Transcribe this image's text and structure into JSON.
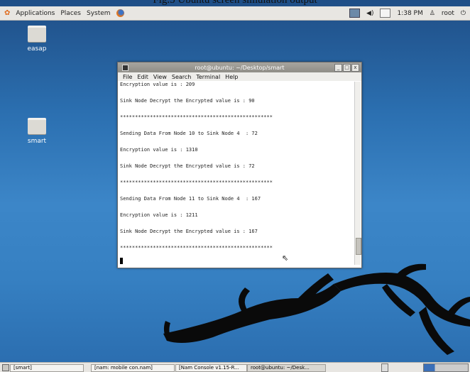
{
  "caption": "Fig.5 Ubuntu screen simulation output",
  "topbar": {
    "menus": [
      "Applications",
      "Places",
      "System"
    ],
    "time": "1:38 PM",
    "user": "root",
    "icons": [
      "gnome-foot-icon",
      "firefox-icon",
      "network-icon",
      "volume-icon",
      "mail-icon",
      "user-icon",
      "power-icon"
    ]
  },
  "desktop_icons": [
    {
      "label": "easap",
      "icon": "folder-icon"
    },
    {
      "label": "smart",
      "icon": "folder-icon"
    }
  ],
  "terminal": {
    "title": "root@ubuntu: ~/Desktop/smart",
    "window_buttons": [
      "_",
      "□",
      "x"
    ],
    "menu": [
      "File",
      "Edit",
      "View",
      "Search",
      "Terminal",
      "Help"
    ],
    "lines": [
      "Encryption value is : 209",
      "",
      "Sink Node Decrypt the Encrypted value is : 90",
      "",
      "***************************************************",
      "",
      "Sending Data From Node 10 to Sink Node 4  : 72",
      "",
      "Encryption value is : 1310",
      "",
      "Sink Node Decrypt the Encrypted value is : 72",
      "",
      "***************************************************",
      "",
      "Sending Data From Node 11 to Sink Node 4  : 167",
      "",
      "Encryption value is : 1211",
      "",
      "Sink Node Decrypt the Encrypted value is : 167",
      "",
      "***************************************************"
    ]
  },
  "taskbar": {
    "items": [
      "[smart]",
      "[nam: mobile con.nam]",
      "[Nam Console v1.15-R...",
      "root@ubuntu: ~/Desk..."
    ]
  }
}
